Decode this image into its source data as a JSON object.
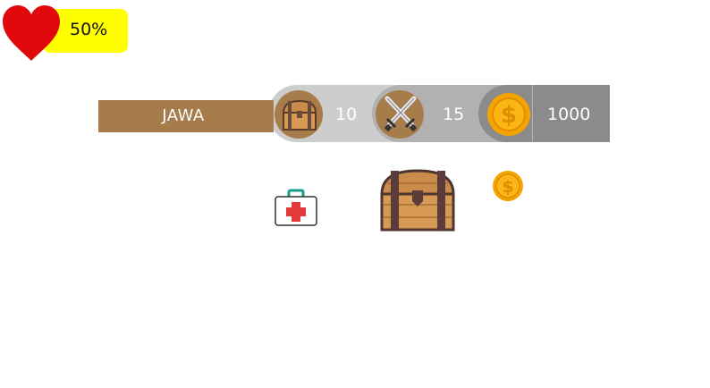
{
  "health": {
    "value_text": "50%",
    "percent": 50,
    "pill_color": "#ffff00",
    "heart_color": "#e0080b",
    "icon": "heart-icon"
  },
  "hud": {
    "player_name": "JAWA",
    "chests": {
      "icon": "treasure-chest-icon",
      "count": "10"
    },
    "swords": {
      "icon": "crossed-swords-icon",
      "count": "15"
    },
    "gold": {
      "icon": "gold-coin-icon",
      "count": "1000"
    },
    "colors": {
      "name_bg": "#a67d4a",
      "seg_light": "#cdcdcd",
      "seg_mid": "#b1b1b1",
      "seg_dark": "#8b8b8b"
    }
  },
  "world": {
    "items": [
      {
        "icon": "medkit-icon"
      },
      {
        "icon": "treasure-chest-icon"
      },
      {
        "icon": "gold-coin-icon"
      }
    ]
  }
}
